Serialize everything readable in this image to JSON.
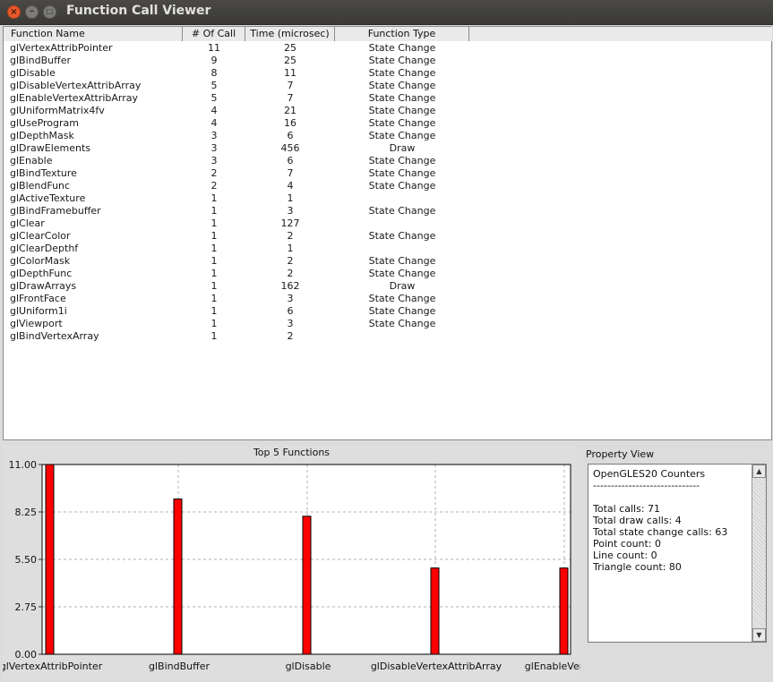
{
  "window": {
    "title": "Function Call Viewer",
    "close_glyph": "×",
    "min_glyph": "–",
    "max_glyph": "□"
  },
  "table": {
    "columns": [
      "Function Name",
      "# Of Call",
      "Time (microsec)",
      "Function Type"
    ],
    "rows": [
      [
        "glVertexAttribPointer",
        "11",
        "25",
        "State Change"
      ],
      [
        "glBindBuffer",
        "9",
        "25",
        "State Change"
      ],
      [
        "glDisable",
        "8",
        "11",
        "State Change"
      ],
      [
        "glDisableVertexAttribArray",
        "5",
        "7",
        "State Change"
      ],
      [
        "glEnableVertexAttribArray",
        "5",
        "7",
        "State Change"
      ],
      [
        "glUniformMatrix4fv",
        "4",
        "21",
        "State Change"
      ],
      [
        "glUseProgram",
        "4",
        "16",
        "State Change"
      ],
      [
        "glDepthMask",
        "3",
        "6",
        "State Change"
      ],
      [
        "glDrawElements",
        "3",
        "456",
        "Draw"
      ],
      [
        "glEnable",
        "3",
        "6",
        "State Change"
      ],
      [
        "glBindTexture",
        "2",
        "7",
        "State Change"
      ],
      [
        "glBlendFunc",
        "2",
        "4",
        "State Change"
      ],
      [
        "glActiveTexture",
        "1",
        "1",
        ""
      ],
      [
        "glBindFramebuffer",
        "1",
        "3",
        "State Change"
      ],
      [
        "glClear",
        "1",
        "127",
        ""
      ],
      [
        "glClearColor",
        "1",
        "2",
        "State Change"
      ],
      [
        "glClearDepthf",
        "1",
        "1",
        ""
      ],
      [
        "glColorMask",
        "1",
        "2",
        "State Change"
      ],
      [
        "glDepthFunc",
        "1",
        "2",
        "State Change"
      ],
      [
        "glDrawArrays",
        "1",
        "162",
        "Draw"
      ],
      [
        "glFrontFace",
        "1",
        "3",
        "State Change"
      ],
      [
        "glUniform1i",
        "1",
        "6",
        "State Change"
      ],
      [
        "glViewport",
        "1",
        "3",
        "State Change"
      ],
      [
        "glBindVertexArray",
        "1",
        "2",
        ""
      ]
    ]
  },
  "chart_data": {
    "type": "bar",
    "title": "Top 5 Functions",
    "categories": [
      "glVertexAttribPointer",
      "glBindBuffer",
      "glDisable",
      "glDisableVertexAttribArray",
      "glEnableVertexAttribArray"
    ],
    "category_labels": [
      "glVertexAttribPointer",
      "glBindBuffer",
      "glDisable",
      "glDisableVertexAttribArray",
      "glEnableVertexA"
    ],
    "values": [
      11,
      9,
      8,
      5,
      5
    ],
    "ylim": [
      0,
      11
    ],
    "yticks": [
      "0.00",
      "2.75",
      "5.50",
      "8.25",
      "11.00"
    ],
    "grid": true,
    "bar_color": "#ff0000"
  },
  "property_view": {
    "title": "Property View",
    "lines": [
      "OpenGLES20 Counters",
      "------------------------------",
      "",
      "Total calls: 71",
      "Total draw calls: 4",
      "Total state change calls: 63",
      "Point count: 0",
      "Line count: 0",
      "Triangle count: 80"
    ],
    "scroll_up_glyph": "▲",
    "scroll_down_glyph": "▼"
  }
}
